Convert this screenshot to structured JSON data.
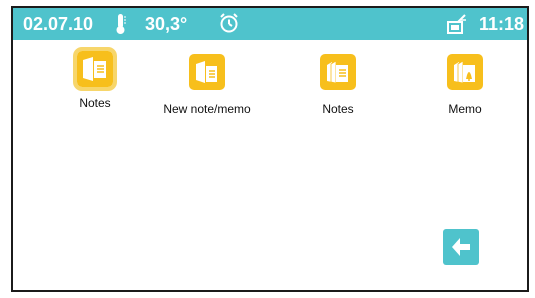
{
  "status_bar": {
    "date": "02.07.10",
    "thermometer_icon": "thermometer-icon",
    "temperature": "30,3°",
    "alarm_icon": "alarm-clock-icon",
    "network_icon": "network-device-icon",
    "time": "11:18"
  },
  "apps": [
    {
      "label": "Notes",
      "icon": "notes-icon",
      "selected": true
    },
    {
      "label": "New note/memo",
      "icon": "new-note-icon",
      "selected": false
    },
    {
      "label": "Notes",
      "icon": "notes-stack-icon",
      "selected": false
    },
    {
      "label": "Memo",
      "icon": "memo-stack-icon",
      "selected": false
    }
  ],
  "back_button": {
    "icon": "back-arrow-icon"
  },
  "colors": {
    "accent": "#4fc3cc",
    "app_tile": "#f7bf1c",
    "selection_ring": "#f7d66b"
  }
}
